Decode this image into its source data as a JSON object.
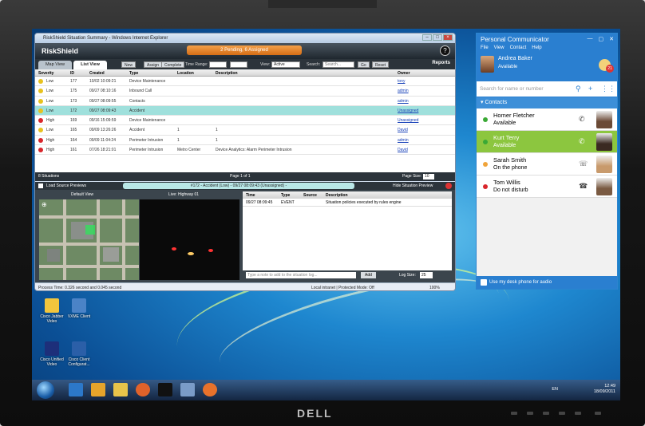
{
  "ie": {
    "title": "RiskShield Situation Summary - Windows Internet Explorer",
    "status_text": "Process Time: 0.326 second and 0.045 second",
    "zone": "Local intranet | Protected Mode: Off",
    "zoom": "100%"
  },
  "riskshield": {
    "logo": "RiskShield",
    "pending": "2 Pending, 6 Assigned",
    "help": "?",
    "tabs": [
      "Map View",
      "List View"
    ],
    "toolbar": {
      "new": "New",
      "assign": "Assign",
      "complete": "Complete",
      "time_range_label": "Time Range:",
      "view_label": "View:",
      "view_value": "Active",
      "search_label": "Search:",
      "search_placeholder": "Search...",
      "go": "Go",
      "reset": "Reset",
      "reports": "Reports"
    },
    "columns": [
      "Severity",
      "ID",
      "Created",
      "Type",
      "Location",
      "Description",
      "Owner"
    ],
    "rows": [
      {
        "severity": "Low",
        "id": "177",
        "created": "10/02 10:09:21",
        "type": "Device Maintenance",
        "location": "",
        "description": "",
        "owner": "tony"
      },
      {
        "severity": "Low",
        "id": "175",
        "created": "09/27 08:10:16",
        "type": "Inbound Call",
        "location": "",
        "description": "",
        "owner": "admin"
      },
      {
        "severity": "Low",
        "id": "173",
        "created": "09/27 08:09:55",
        "type": "Contacts",
        "location": "",
        "description": "",
        "owner": "admin"
      },
      {
        "severity": "Low",
        "id": "172",
        "created": "09/27 08:09:43",
        "type": "Accident",
        "location": "",
        "description": "",
        "owner": "Unassigned"
      },
      {
        "severity": "High",
        "id": "169",
        "created": "09/16 15:09:59",
        "type": "Device Maintenance",
        "location": "",
        "description": "",
        "owner": "Unassigned"
      },
      {
        "severity": "Low",
        "id": "165",
        "created": "09/09 13:26:26",
        "type": "Accident",
        "location": "1",
        "description": "1",
        "owner": "David"
      },
      {
        "severity": "High",
        "id": "164",
        "created": "09/09 11:04:24",
        "type": "Perimeter Intrusion",
        "location": "1",
        "description": "1",
        "owner": "admin"
      },
      {
        "severity": "High",
        "id": "161",
        "created": "07/26 18:21:01",
        "type": "Perimeter Intrusion",
        "location": "Metro Center",
        "description": "Device Analytics: Alarm Perimeter Intrusion",
        "owner": "David"
      }
    ],
    "situations_count": "8 Situations",
    "page": "Page 1 of 1",
    "page_size_label": "Page Size:",
    "page_size": "10",
    "preview": {
      "load_label": "Load Source Previews",
      "title": "#172 - Accident (Low) - 09/27 08:09:43 (Unassigned) -",
      "hide_label": "Hide Situation Preview",
      "map_label": "Default View",
      "cam_label": "Live: Highway 01",
      "event_columns": [
        "Time",
        "Type",
        "Source",
        "Description"
      ],
      "event_row": {
        "time": "09/27 08:09:45",
        "type": "EVENT",
        "source": "",
        "description": "Situation policies executed by rules engine"
      },
      "note_placeholder": "Type a note to add to the situation log...",
      "add": "Add",
      "log_size_label": "Log Size:",
      "log_size": "25"
    }
  },
  "communicator": {
    "title": "Personal Communicator",
    "menu": [
      "File",
      "View",
      "Contact",
      "Help"
    ],
    "user_name": "Andrea Baker",
    "user_status": "Available",
    "calendar_badge": "21",
    "search_placeholder": "Search for name or number",
    "group": "Contacts",
    "contacts": [
      {
        "name": "Homer Fletcher",
        "status": "Available",
        "color": "#3aa935"
      },
      {
        "name": "Kurt Terry",
        "status": "Available",
        "color": "#3aa935"
      },
      {
        "name": "Sarah Smith",
        "status": "On the phone",
        "color": "#f0a43a"
      },
      {
        "name": "Tom Willis",
        "status": "Do not disturb",
        "color": "#d9262c"
      }
    ],
    "footer": "Use my desk phone for audio"
  },
  "desktop_icons": [
    {
      "label": "Cisco Jabber Video",
      "color": "#f2c53d"
    },
    {
      "label": "VXME Client",
      "color": "#4b83c7"
    },
    {
      "label": "Cisco Unified Video",
      "color": "#1d2f7a"
    },
    {
      "label": "Cisco Client Configurat...",
      "color": "#2b5fa8"
    }
  ],
  "taskbar": {
    "lang": "EN",
    "time": "12:49",
    "date": "18/09/2011"
  },
  "bezel": {
    "brand": "DELL"
  }
}
